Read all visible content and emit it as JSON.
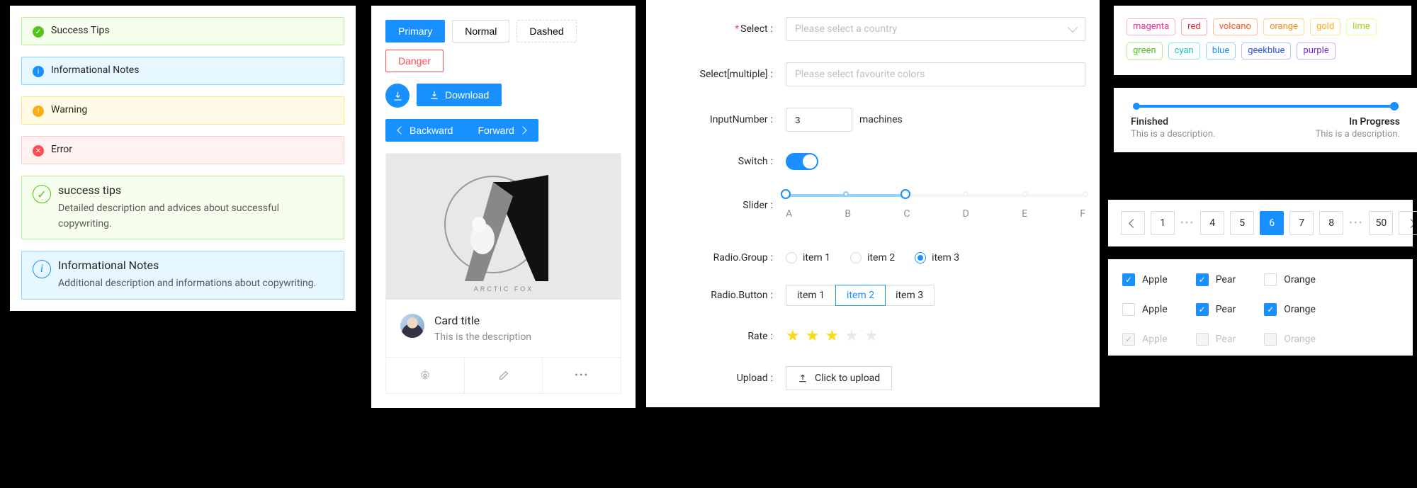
{
  "alerts": {
    "success": {
      "msg": "Success Tips"
    },
    "info": {
      "msg": "Informational Notes"
    },
    "warning": {
      "msg": "Warning"
    },
    "error": {
      "msg": "Error"
    },
    "successBig": {
      "title": "success tips",
      "desc": "Detailed description and advices about successful copywriting."
    },
    "infoBig": {
      "title": "Informational Notes",
      "desc": "Additional description and informations about copywriting."
    }
  },
  "buttons": {
    "primary": "Primary",
    "normal": "Normal",
    "dashed": "Dashed",
    "danger": "Danger",
    "download": "Download",
    "backward": "Backward",
    "forward": "Forward"
  },
  "card": {
    "coverCaption": "ARCTIC FOX",
    "title": "Card title",
    "desc": "This is the description"
  },
  "form": {
    "select": {
      "label": "Select",
      "placeholder": "Please select a country"
    },
    "multiSelect": {
      "label": "Select[multiple]",
      "placeholder": "Please select favourite colors"
    },
    "inputNumber": {
      "label": "InputNumber",
      "value": "3",
      "suffix": "machines"
    },
    "switch": {
      "label": "Switch",
      "value": true
    },
    "slider": {
      "label": "Slider",
      "value": "C",
      "marks": [
        "A",
        "B",
        "C",
        "D",
        "E",
        "F"
      ]
    },
    "radioGroup": {
      "label": "Radio.Group",
      "items": [
        "item 1",
        "item 2",
        "item 3"
      ],
      "selected": 2
    },
    "radioButton": {
      "label": "Radio.Button",
      "items": [
        "item 1",
        "item 2",
        "item 3"
      ],
      "selected": 1
    },
    "rate": {
      "label": "Rate",
      "value": 3,
      "max": 5
    },
    "upload": {
      "label": "Upload",
      "btn": "Click to upload"
    }
  },
  "tags": [
    {
      "text": "magenta",
      "color": "#eb2f96",
      "border": "#ffadd6"
    },
    {
      "text": "red",
      "color": "#f5222d",
      "border": "#ffa39e"
    },
    {
      "text": "volcano",
      "color": "#fa541c",
      "border": "#ffbb96"
    },
    {
      "text": "orange",
      "color": "#fa8c16",
      "border": "#ffd591"
    },
    {
      "text": "gold",
      "color": "#faad14",
      "border": "#ffe58f"
    },
    {
      "text": "lime",
      "color": "#a0d911",
      "border": "#eaff8f"
    },
    {
      "text": "green",
      "color": "#52c41a",
      "border": "#b7eb8f"
    },
    {
      "text": "cyan",
      "color": "#13c2c2",
      "border": "#87e8de"
    },
    {
      "text": "blue",
      "color": "#1890ff",
      "border": "#91d5ff"
    },
    {
      "text": "geekblue",
      "color": "#2f54eb",
      "border": "#adc6ff"
    },
    {
      "text": "purple",
      "color": "#722ed1",
      "border": "#d3adf7"
    }
  ],
  "steps": {
    "step1": {
      "title": "Finished",
      "desc": "This is a description."
    },
    "step2": {
      "title": "In Progress",
      "desc": "This is a description."
    }
  },
  "pagination": {
    "pages": [
      "1",
      "4",
      "5",
      "6",
      "7",
      "8",
      "50"
    ],
    "active": "6"
  },
  "checkboxes": {
    "labels": {
      "apple": "Apple",
      "pear": "Pear",
      "orange": "Orange"
    },
    "row1": {
      "apple": true,
      "pear": true,
      "orange": false
    },
    "row2": {
      "apple": false,
      "pear": true,
      "orange": true
    },
    "row3_disabled": {
      "apple": true,
      "pear": false,
      "orange": false
    }
  }
}
